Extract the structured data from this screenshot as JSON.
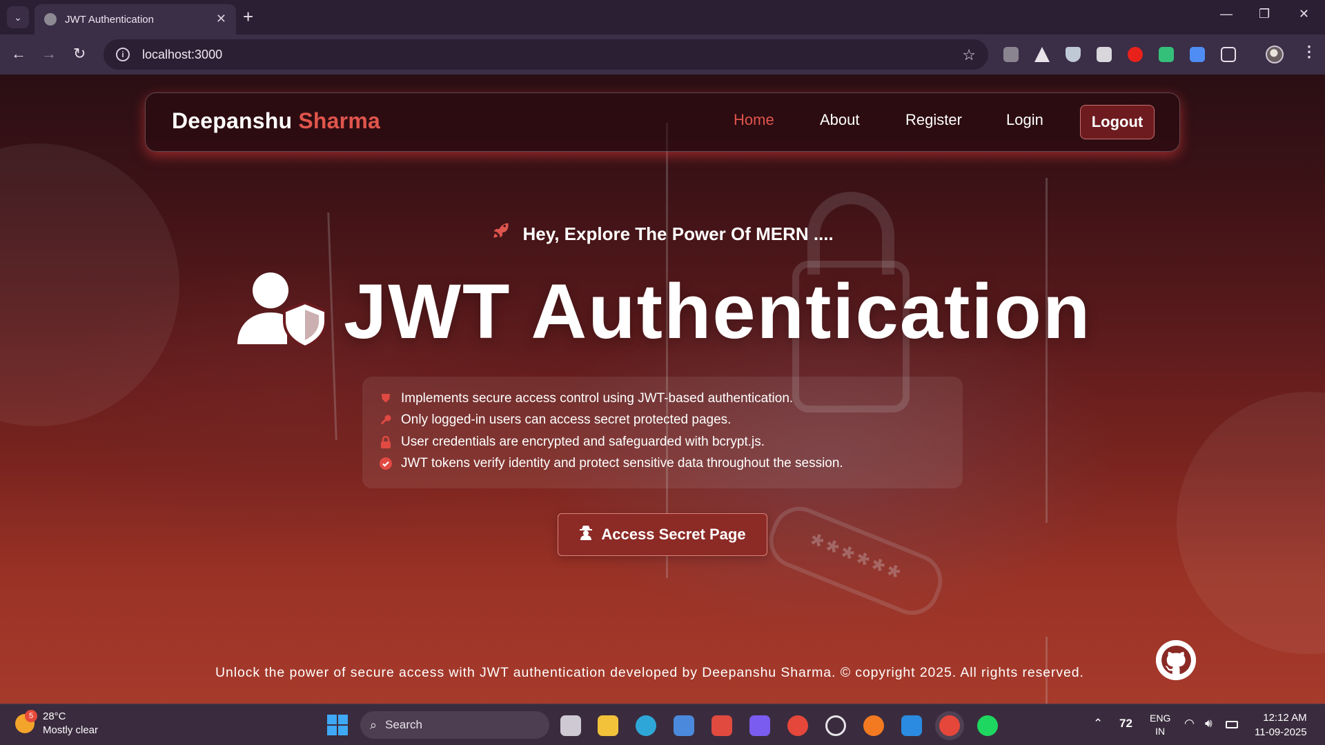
{
  "browser": {
    "tab_title": "JWT Authentication",
    "tab_close": "✕",
    "new_tab": "+",
    "url": "localhost:3000",
    "minimize": "—",
    "restore": "❐",
    "close": "✕"
  },
  "navbar": {
    "brand_first": "Deepanshu",
    "brand_last": "Sharma",
    "items": [
      "Home",
      "About",
      "Register",
      "Login"
    ],
    "active_item": "Home",
    "logout_label": "Logout"
  },
  "hero": {
    "kicker": "Hey, Explore The Power Of MERN ....",
    "title": "JWT Authentication",
    "features": [
      {
        "icon": "shield-icon",
        "text": "Implements secure access control using JWT-based authentication."
      },
      {
        "icon": "key-icon",
        "text": "Only logged-in users can access secret protected pages."
      },
      {
        "icon": "lock-icon",
        "text": "User credentials are encrypted and safeguarded with bcrypt.js."
      },
      {
        "icon": "check-circle-icon",
        "text": "JWT tokens verify identity and protect sensitive data throughout the session."
      }
    ],
    "cta_label": "Access Secret Page"
  },
  "footer": {
    "text": "Unlock the power of secure access with JWT authentication developed by Deepanshu Sharma. © copyright 2025. All rights reserved."
  },
  "background": {
    "password_mask": "******"
  },
  "taskbar": {
    "weather_badge": "5",
    "temperature": "28°C",
    "condition": "Mostly clear",
    "search_label": "Search",
    "tray_number": "72",
    "lang_top": "ENG",
    "lang_bottom": "IN",
    "time": "12:12 AM",
    "date": "11-09-2025"
  },
  "colors": {
    "accent": "#e0554d",
    "accent_dark": "#8c2a26"
  }
}
